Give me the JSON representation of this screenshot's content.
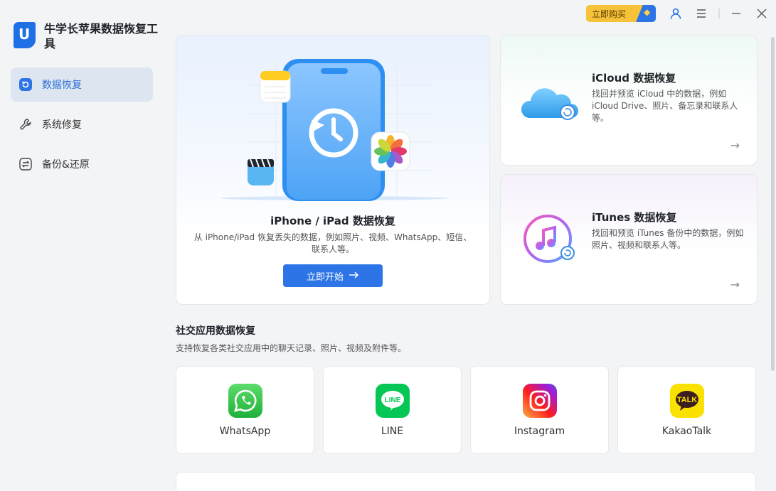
{
  "app": {
    "name": "牛学长苹果数据恢复工具",
    "logo_letter": "U"
  },
  "sidebar": {
    "items": [
      {
        "label": "数据恢复",
        "icon": "refresh-icon",
        "active": true
      },
      {
        "label": "系统修复",
        "icon": "wrench-icon",
        "active": false
      },
      {
        "label": "备份&还原",
        "icon": "backup-icon",
        "active": false
      }
    ]
  },
  "topbar": {
    "buy_label": "立即购买"
  },
  "hero": {
    "title": "iPhone / iPad 数据恢复",
    "desc": "从 iPhone/iPad 恢复丢失的数据，例如照片、视频、WhatsApp、短信、联系人等。",
    "button": "立即开始"
  },
  "icloud": {
    "title": "iCloud 数据恢复",
    "desc": "找回并预览 iCloud 中的数据，例如 iCloud Drive、照片、备忘录和联系人等。"
  },
  "itunes": {
    "title": "iTunes 数据恢复",
    "desc": "找回和预览 iTunes 备份中的数据，例如照片、视频和联系人等。"
  },
  "social": {
    "title": "社交应用数据恢复",
    "desc": "支持恢复各类社交应用中的聊天记录、照片、视频及附件等。",
    "apps": [
      {
        "label": "WhatsApp"
      },
      {
        "label": "LINE"
      },
      {
        "label": "Instagram"
      },
      {
        "label": "KakaoTalk"
      }
    ]
  },
  "colors": {
    "accent": "#2d74e6",
    "buy": "#f6c23a",
    "active_nav_bg": "#dce5f0"
  }
}
